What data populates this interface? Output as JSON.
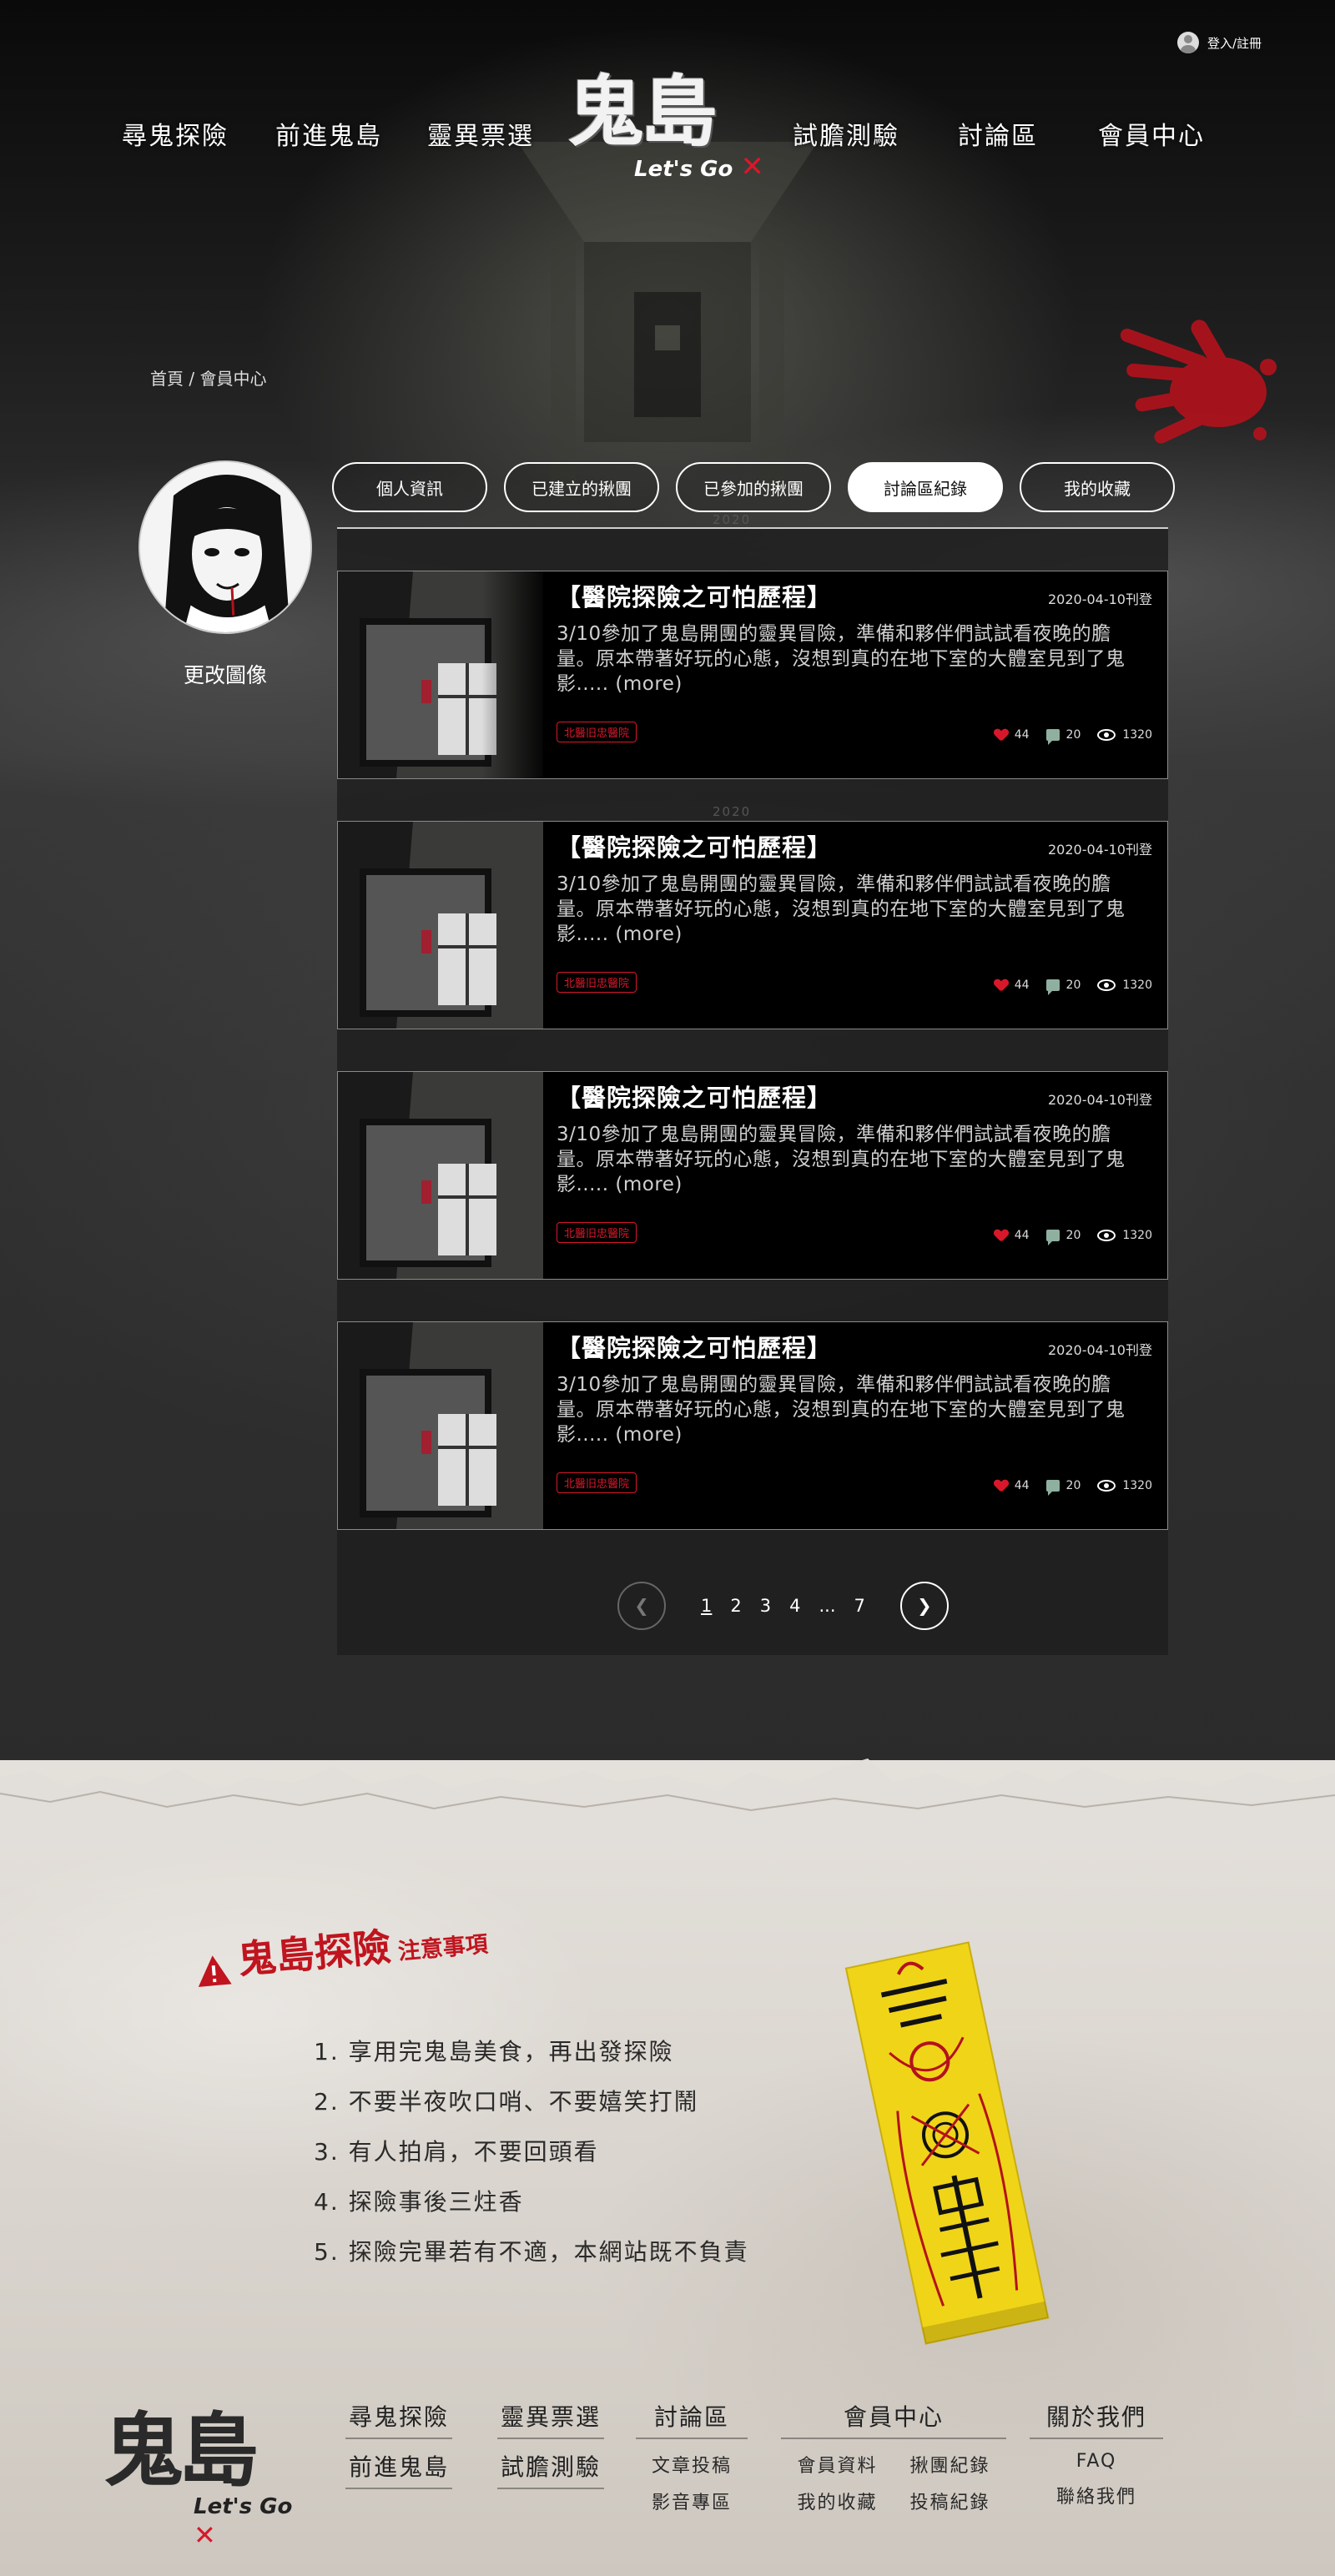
{
  "header": {
    "login_label": "登入/註冊",
    "nav_left": [
      "尋鬼探險",
      "前進鬼島",
      "靈異票選"
    ],
    "nav_right": [
      "試膽測驗",
      "討論區",
      "會員中心"
    ],
    "logo_main": "鬼島",
    "logo_sub": "Let's Go"
  },
  "breadcrumb": {
    "home": "首頁",
    "separator": "/",
    "current": "會員中心"
  },
  "profile": {
    "change_photo": "更改圖像"
  },
  "tabs": [
    "個人資訊",
    "已建立的揪團",
    "已參加的揪團",
    "討論區紀錄",
    "我的收藏"
  ],
  "active_tab": "討論區紀錄",
  "posts": [
    {
      "title": "【醫院探險之可怕歷程】",
      "date": "2020-04-10刊登",
      "body": "3/10參加了鬼島開團的靈異冒險，準備和夥伴們試試看夜晚的膽量。原本帶著好玩的心態，沒想到真的在地下室的大體室見到了鬼影..... (more)",
      "tag": "北醫旧忠醫院",
      "likes": "44",
      "comments": "20",
      "views": "1320"
    },
    {
      "title": "【醫院探險之可怕歷程】",
      "date": "2020-04-10刊登",
      "body": "3/10參加了鬼島開團的靈異冒險，準備和夥伴們試試看夜晚的膽量。原本帶著好玩的心態，沒想到真的在地下室的大體室見到了鬼影..... (more)",
      "tag": "北醫旧忠醫院",
      "likes": "44",
      "comments": "20",
      "views": "1320"
    },
    {
      "title": "【醫院探險之可怕歷程】",
      "date": "2020-04-10刊登",
      "body": "3/10參加了鬼島開團的靈異冒險，準備和夥伴們試試看夜晚的膽量。原本帶著好玩的心態，沒想到真的在地下室的大體室見到了鬼影..... (more)",
      "tag": "北醫旧忠醫院",
      "likes": "44",
      "comments": "20",
      "views": "1320"
    },
    {
      "title": "【醫院探險之可怕歷程】",
      "date": "2020-04-10刊登",
      "body": "3/10參加了鬼島開團的靈異冒險，準備和夥伴們試試看夜晚的膽量。原本帶著好玩的心態，沒想到真的在地下室的大體室見到了鬼影..... (more)",
      "tag": "北醫旧忠醫院",
      "likes": "44",
      "comments": "20",
      "views": "1320"
    }
  ],
  "year_marks": [
    "2020",
    "2020"
  ],
  "pagination": {
    "pages": [
      "1",
      "2",
      "3",
      "4",
      "...",
      "7"
    ],
    "current": "1"
  },
  "notice": {
    "title_big": "鬼島探險",
    "title_small": "注意事項",
    "rules": [
      "1. 享用完鬼島美食，再出發探險",
      "2. 不要半夜吹口哨、不要嬉笑打鬧",
      "3. 有人拍肩，不要回頭看",
      "4. 探險事後三炷香",
      "5. 探險完畢若有不適，本網站既不負責"
    ]
  },
  "footer": {
    "logo_main": "鬼島",
    "logo_sub": "Let's Go",
    "col1": [
      "尋鬼探險",
      "前進鬼島"
    ],
    "col2": [
      "靈異票選",
      "試膽測驗"
    ],
    "col3": {
      "head": "討論區",
      "links": [
        "文章投稿",
        "影音專區"
      ]
    },
    "col4": {
      "head": "會員中心",
      "links": [
        "會員資料",
        "揪團紀錄",
        "我的收藏",
        "投稿紀錄"
      ]
    },
    "col5": {
      "head": "關於我們",
      "links": [
        "FAQ",
        "聯絡我們"
      ]
    }
  },
  "colors": {
    "accent_red": "#d8182a",
    "background_dark": "#2b2b2b",
    "paper": "#dcd7d0"
  }
}
